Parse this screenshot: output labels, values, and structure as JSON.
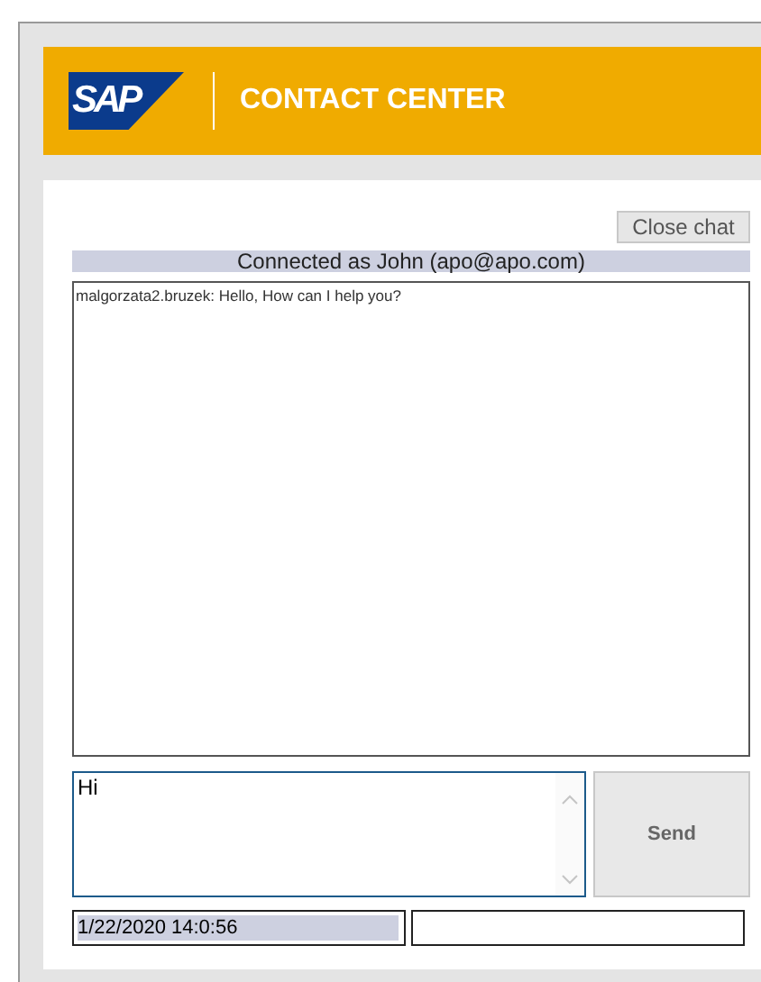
{
  "header": {
    "logo": "SAP",
    "title": "CONTACT CENTER"
  },
  "close_button": "Close chat",
  "connection_status": "Connected as John (apo@apo.com)",
  "transcript": [
    "malgorzata2.bruzek: Hello, How can I help you?"
  ],
  "message_input": {
    "value": "Hi"
  },
  "send_button": "Send",
  "status_bar": {
    "timestamp": "1/22/2020 14:0:56"
  }
}
